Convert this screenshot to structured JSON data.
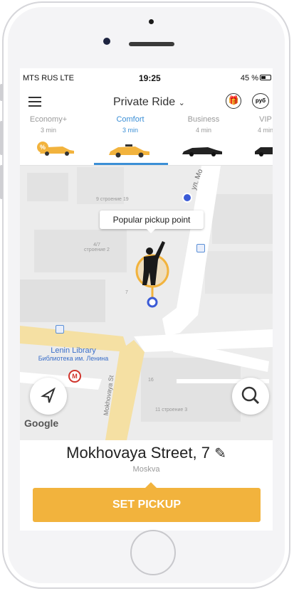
{
  "status_bar": {
    "carrier": "MTS RUS  LTE",
    "time": "19:25",
    "battery": "45 %"
  },
  "header": {
    "title": "Private Ride",
    "gift_icon": "gift-icon",
    "currency_label": "руб"
  },
  "ride_classes": [
    {
      "name": "Economy+",
      "eta": "3 min",
      "badge": "%"
    },
    {
      "name": "Comfort",
      "eta": "3 min",
      "active": true
    },
    {
      "name": "Business",
      "eta": "4 min"
    },
    {
      "name": "VIP",
      "eta": "4 min"
    }
  ],
  "map": {
    "tooltip": "Popular pickup point",
    "street_top": "ул. Мо",
    "street_left": "Vozdvizhenka",
    "street_bottom": "Mokhovaya St",
    "building_labels": [
      "9 строение 19",
      "4/7 строение 2",
      "7",
      "16",
      "11 строение 3"
    ],
    "library_en": "Lenin Library",
    "library_ru": "Библиотека им. Ленина",
    "metro_label": "М",
    "attribution": "Google"
  },
  "address": {
    "street": "Mokhovaya Street, 7",
    "city": "Moskva"
  },
  "actions": {
    "set_pickup": "SET PICKUP"
  },
  "colors": {
    "accent_blue": "#3b8fd6",
    "pickup_orange": "#f2b33d",
    "road_yellow": "#f5e0a3"
  }
}
